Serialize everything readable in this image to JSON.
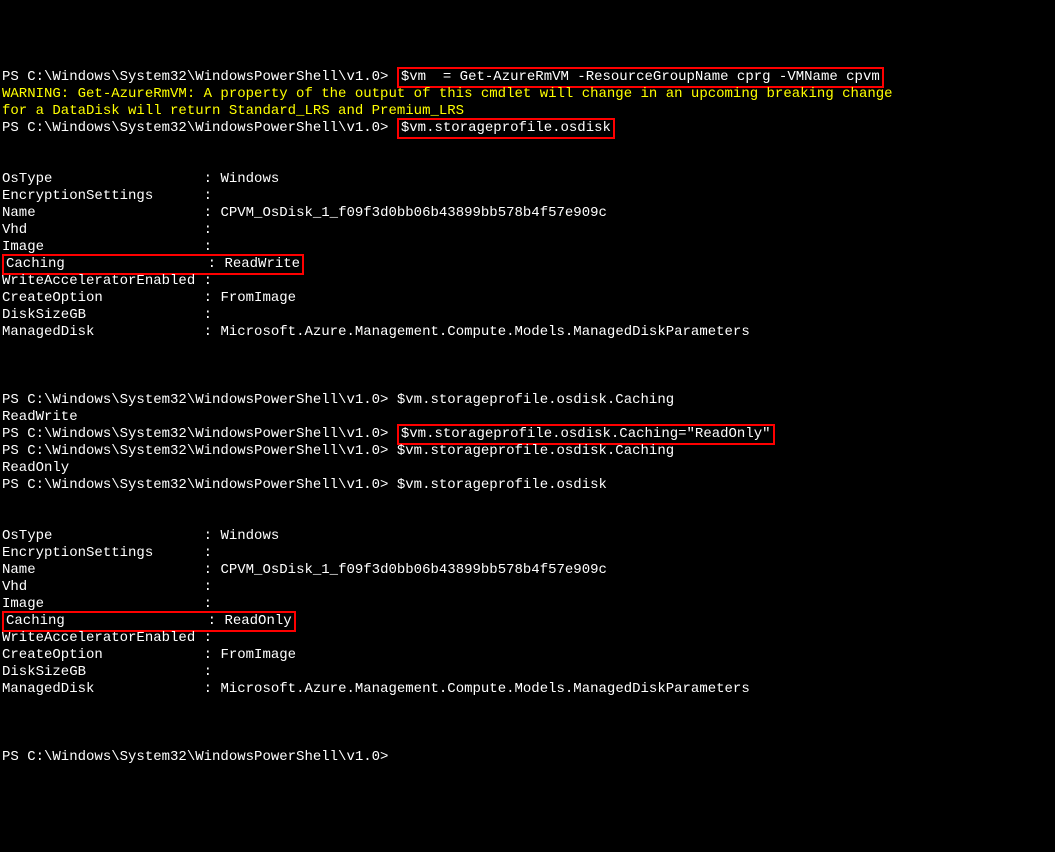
{
  "prompt_path": "PS C:\\Windows\\System32\\WindowsPowerShell\\v1.0> ",
  "commands": {
    "cmd1": "$vm  = Get-AzureRmVM -ResourceGroupName cprg -VMName cpvm",
    "cmd2": "$vm.storageprofile.osdisk",
    "cmd3": "$vm.storageprofile.osdisk.Caching",
    "cmd4": "$vm.storageprofile.osdisk.Caching=\"ReadOnly\"",
    "cmd5": "$vm.storageprofile.osdisk.Caching",
    "cmd6": "$vm.storageprofile.osdisk"
  },
  "warning": {
    "line1": "WARNING: Get-AzureRmVM: A property of the output of this cmdlet will change in an upcoming breaking change",
    "line2": "for a DataDisk will return Standard_LRS and Premium_LRS"
  },
  "output1": {
    "OsType_label": "OsType",
    "OsType_value": "Windows",
    "EncryptionSettings_label": "EncryptionSettings",
    "EncryptionSettings_value": "",
    "Name_label": "Name",
    "Name_value": "CPVM_OsDisk_1_f09f3d0bb06b43899bb578b4f57e909c",
    "Vhd_label": "Vhd",
    "Vhd_value": "",
    "Image_label": "Image",
    "Image_value": "",
    "Caching_label": "Caching",
    "Caching_value": "ReadWrite",
    "WriteAcceleratorEnabled_label": "WriteAcceleratorEnabled",
    "WriteAcceleratorEnabled_value": "",
    "CreateOption_label": "CreateOption",
    "CreateOption_value": "FromImage",
    "DiskSizeGB_label": "DiskSizeGB",
    "DiskSizeGB_value": "",
    "ManagedDisk_label": "ManagedDisk",
    "ManagedDisk_value": "Microsoft.Azure.Management.Compute.Models.ManagedDiskParameters"
  },
  "caching_output1": "ReadWrite",
  "caching_output2": "ReadOnly",
  "output2": {
    "OsType_label": "OsType",
    "OsType_value": "Windows",
    "EncryptionSettings_label": "EncryptionSettings",
    "EncryptionSettings_value": "",
    "Name_label": "Name",
    "Name_value": "CPVM_OsDisk_1_f09f3d0bb06b43899bb578b4f57e909c",
    "Vhd_label": "Vhd",
    "Vhd_value": "",
    "Image_label": "Image",
    "Image_value": "",
    "Caching_label": "Caching",
    "Caching_value": "ReadOnly",
    "WriteAcceleratorEnabled_label": "WriteAcceleratorEnabled",
    "WriteAcceleratorEnabled_value": "",
    "CreateOption_label": "CreateOption",
    "CreateOption_value": "FromImage",
    "DiskSizeGB_label": "DiskSizeGB",
    "DiskSizeGB_value": "",
    "ManagedDisk_label": "ManagedDisk",
    "ManagedDisk_value": "Microsoft.Azure.Management.Compute.Models.ManagedDiskParameters"
  }
}
